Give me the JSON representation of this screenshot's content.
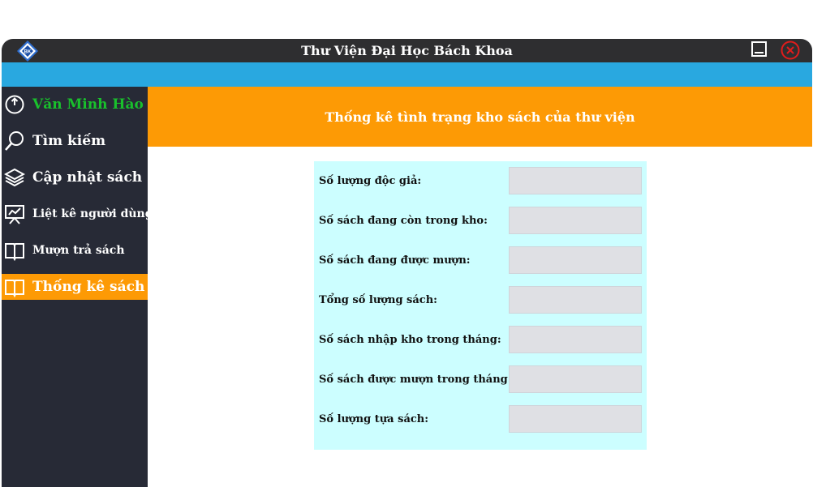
{
  "window": {
    "title": "Thư Viện Đại Học Bách Khoa"
  },
  "icons": {
    "app_logo": "bk-university-logo-icon",
    "minimize": "minimize-icon",
    "close": "close-circle-icon"
  },
  "colors": {
    "titlebar": "#2e2e30",
    "accent_blue": "#29a8e0",
    "sidebar": "#272a36",
    "active_orange": "#fd9a05",
    "user_green": "#19c02c",
    "panel_bg": "#ccfeff",
    "field_bg": "#dfe0e4"
  },
  "sidebar": {
    "items": [
      {
        "label": "Văn Minh Hào",
        "icon": "power-icon"
      },
      {
        "label": "Tìm kiếm",
        "icon": "search-icon"
      },
      {
        "label": "Cập nhật sách",
        "icon": "layers-icon"
      },
      {
        "label": "Liệt kê người dùng",
        "icon": "presentation-chart-icon"
      },
      {
        "label": "Mượn trả sách",
        "icon": "open-book-icon"
      },
      {
        "label": "Thống kê sách",
        "icon": "open-book-icon",
        "active": true
      }
    ]
  },
  "main": {
    "title": "Thống kê tình trạng kho sách của thư viện",
    "stats": [
      {
        "label": "Số lượng độc giả:",
        "value": ""
      },
      {
        "label": "Số sách đang còn trong kho:",
        "value": ""
      },
      {
        "label": "Số sách đang được mượn:",
        "value": ""
      },
      {
        "label": "Tổng số lượng sách:",
        "value": ""
      },
      {
        "label": "Số sách nhập kho trong tháng:",
        "value": ""
      },
      {
        "label": "Số sách được mượn trong tháng:",
        "value": ""
      },
      {
        "label": "Số lượng tựa sách:",
        "value": ""
      }
    ]
  }
}
